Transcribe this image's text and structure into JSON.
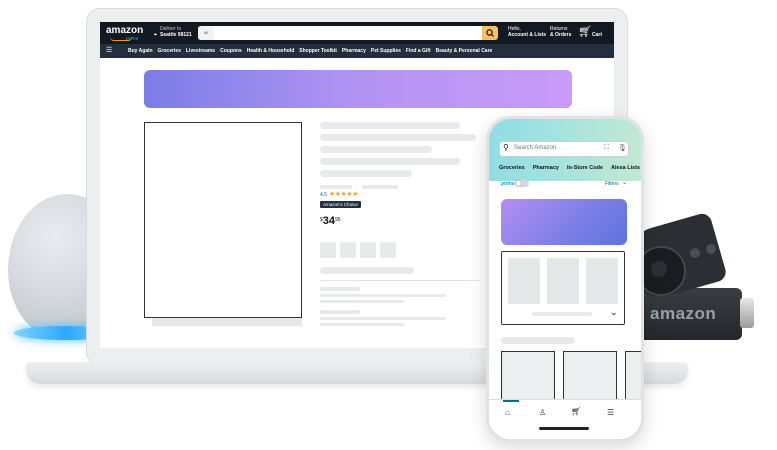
{
  "laptop": {
    "logo": "amazon",
    "logo_sub": "prime",
    "deliver_line1": "Deliver to",
    "deliver_line2": "Seattle 98121",
    "search_dropdown": "All",
    "account_line1": "Hello,",
    "account_line2": "Account & Lists",
    "returns_line1": "Returns",
    "returns_line2": "& Orders",
    "cart_label": "Cart",
    "nav": [
      "Buy Again",
      "Groceries",
      "Livestreams",
      "Coupons",
      "Health & Household",
      "Shopper Toolkit",
      "Pharmacy",
      "Pet Supplies",
      "Find a Gift",
      "Beauty & Personal Care"
    ],
    "rating": "4.5",
    "stars": "★★★★★",
    "badge": "Amazon's Choice",
    "price_currency": "$",
    "price_whole": "34",
    "price_fraction": "95"
  },
  "phone": {
    "search_placeholder": "Search Amazon",
    "categories": [
      "Groceries",
      "Pharmacy",
      "In-Store Code",
      "Alexa Lists"
    ],
    "prime_label": "prime",
    "filters_label": "Filters"
  },
  "devices": {
    "stick_logo": "amazon"
  },
  "colors": {
    "header": "#131921",
    "nav": "#232f3e",
    "search_button": "#febd69",
    "badge": "#232f3e",
    "star": "#ffa41c",
    "link": "#007185"
  }
}
